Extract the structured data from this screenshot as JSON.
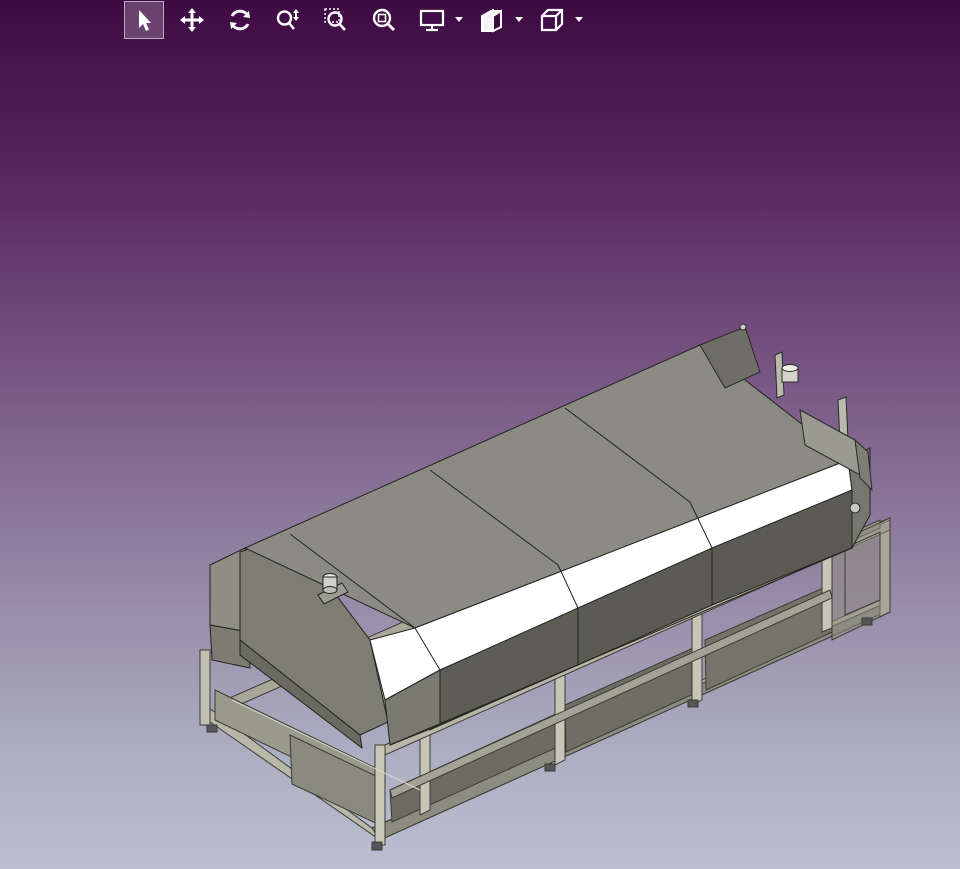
{
  "toolbar": {
    "tools": [
      {
        "icon": "select-arrow-icon",
        "active": true
      },
      {
        "icon": "pan-move-icon",
        "active": false
      },
      {
        "icon": "rotate-icon",
        "active": false
      },
      {
        "icon": "zoom-icon",
        "active": false
      },
      {
        "icon": "zoom-window-icon",
        "active": false
      },
      {
        "icon": "zoom-fit-icon",
        "active": false
      },
      {
        "icon": "display-mode-icon",
        "active": false,
        "dropdown": true
      },
      {
        "icon": "section-plane-icon",
        "active": false,
        "dropdown": true
      },
      {
        "icon": "view-cube-icon",
        "active": false,
        "dropdown": true
      }
    ]
  },
  "viewport": {
    "background_top": "#3e0a43",
    "background_bottom": "#b9bfd0",
    "model": "reflow-oven-cad-assembly"
  }
}
